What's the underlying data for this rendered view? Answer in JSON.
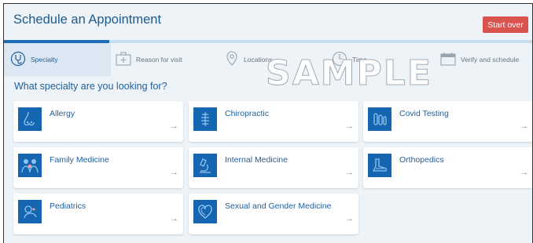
{
  "header": {
    "title": "Schedule an Appointment",
    "start_over_label": "Start over"
  },
  "progress": {
    "fraction": 0.2
  },
  "steps": [
    {
      "label": "Specialty",
      "icon": "stethoscope-icon",
      "active": true
    },
    {
      "label": "Reason for visit",
      "icon": "first-aid-kit-icon",
      "active": false
    },
    {
      "label": "Locations",
      "icon": "location-pin-icon",
      "active": false
    },
    {
      "label": "Time",
      "icon": "clock-icon",
      "active": false
    },
    {
      "label": "Verify and schedule",
      "icon": "calendar-icon",
      "active": false
    }
  ],
  "watermark": "SAMPLE",
  "question": "What specialty are you looking for?",
  "specialties": [
    {
      "label": "Allergy",
      "icon": "nose-icon"
    },
    {
      "label": "Chiropractic",
      "icon": "spine-icon"
    },
    {
      "label": "Covid Testing",
      "icon": "test-tubes-icon"
    },
    {
      "label": "Family Medicine",
      "icon": "family-icon"
    },
    {
      "label": "Internal Medicine",
      "icon": "microscope-icon"
    },
    {
      "label": "Orthopedics",
      "icon": "foot-bones-icon"
    },
    {
      "label": "Pediatrics",
      "icon": "baby-icon"
    },
    {
      "label": "Sexual and Gender Medicine",
      "icon": "heart-icon"
    }
  ],
  "arrow_glyph": "→",
  "colors": {
    "accent": "#1f6fb8",
    "danger": "#d9534f",
    "tile": "#1565b0"
  }
}
